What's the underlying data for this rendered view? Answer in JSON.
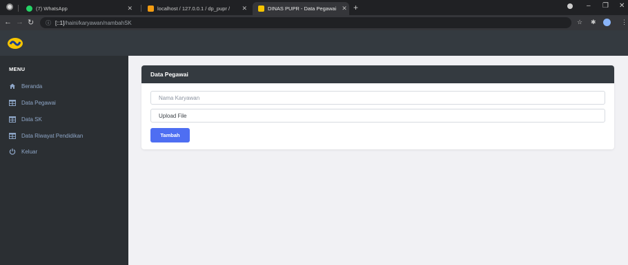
{
  "browser": {
    "tabs": [
      {
        "label": "(7) WhatsApp",
        "active": false
      },
      {
        "label": "localhost / 127.0.0.1 / dp_pupr / ",
        "active": false
      },
      {
        "label": "DINAS PUPR - Data Pegawai",
        "active": true
      }
    ],
    "url_host": "[::1]",
    "url_path": "/haini/karyawan/nambahSK"
  },
  "sidebar": {
    "menu_title": "MENU",
    "items": [
      {
        "label": "Beranda",
        "icon": "home-icon"
      },
      {
        "label": "Data Pegawai",
        "icon": "table-icon"
      },
      {
        "label": "Data SK",
        "icon": "table-icon"
      },
      {
        "label": "Data Riwayat Pendidikan",
        "icon": "table-icon"
      },
      {
        "label": "Keluar",
        "icon": "power-icon"
      }
    ]
  },
  "card": {
    "title": "Data Pegawai",
    "name_placeholder": "Nama Karyawan",
    "file_label": "Upload File",
    "submit_label": "Tambah"
  },
  "colors": {
    "sidebar_bg": "#2b2f33",
    "header_bg": "#343a40",
    "sidebar_text": "#8ea6c7",
    "button": "#4e6ef2"
  }
}
